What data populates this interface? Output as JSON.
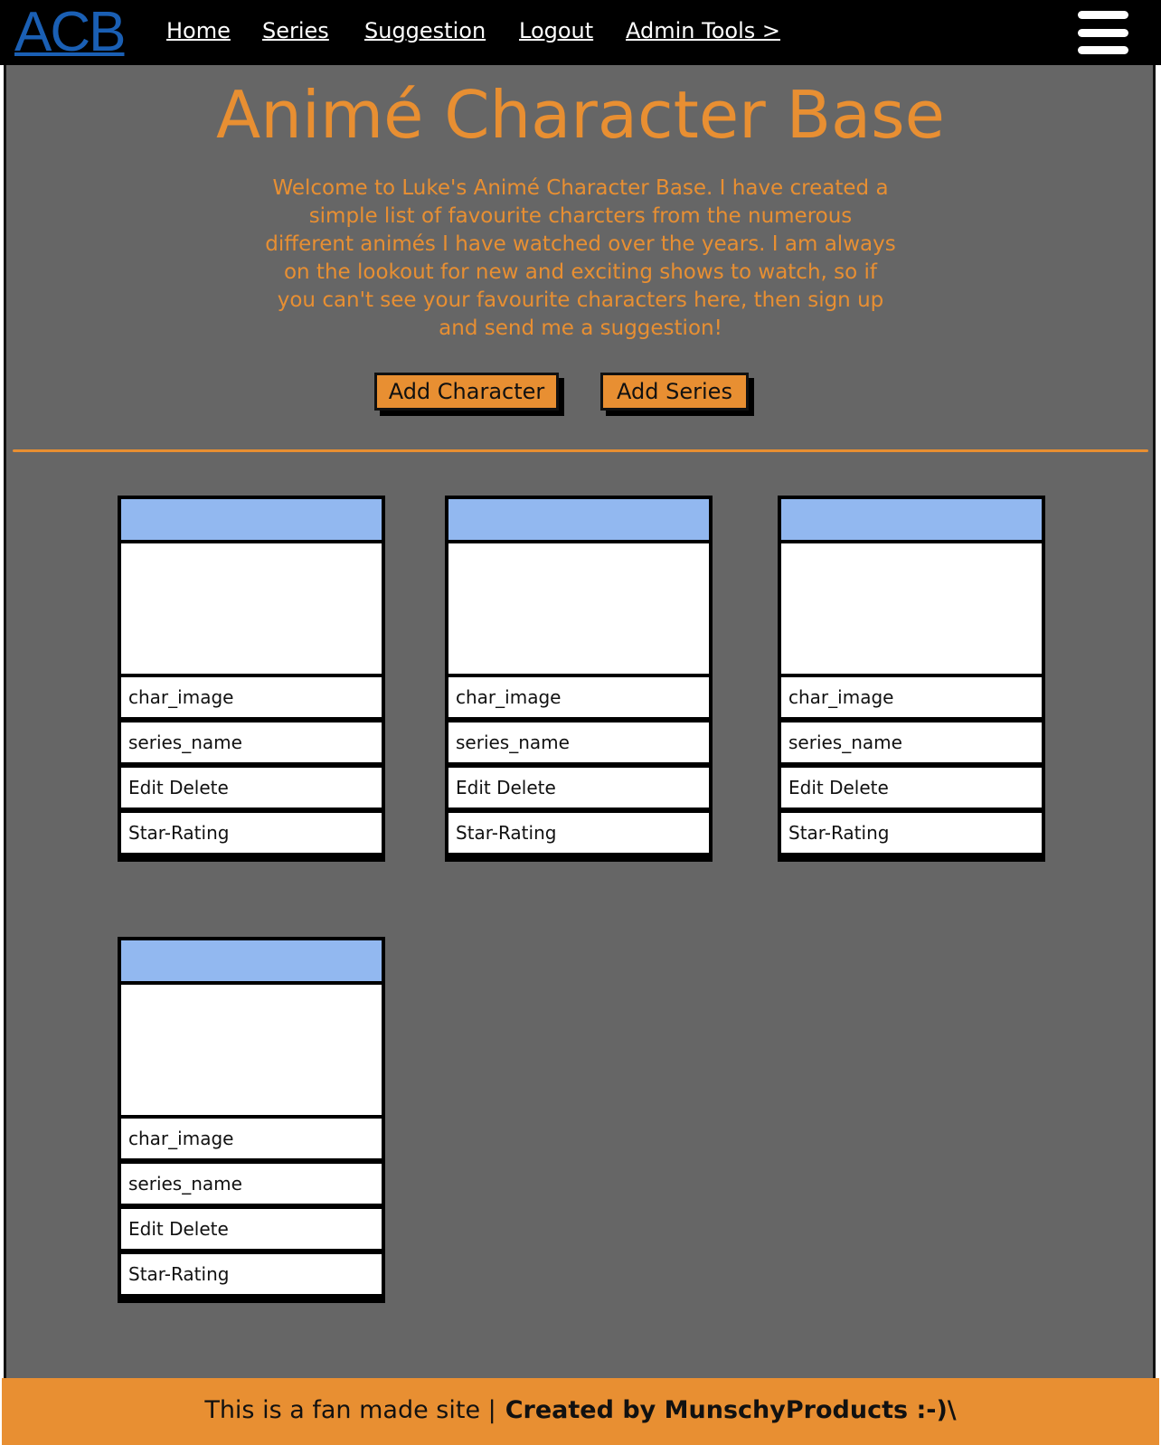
{
  "header": {
    "logo": "ACB",
    "nav": [
      {
        "label": "Home"
      },
      {
        "label": "Series"
      },
      {
        "label": "Suggestion"
      },
      {
        "label": "Logout"
      },
      {
        "label": "Admin Tools >"
      }
    ],
    "menu_icon": "hamburger-menu-icon"
  },
  "main": {
    "title": "Animé Character Base",
    "intro": "Welcome to Luke's Animé Character Base. I have created a simple list of favourite charcters from the numerous different animés I have watched over the years. I am always on the lookout for new and exciting shows to watch, so if you can't see your favourite characters here, then sign up and send me a suggestion!",
    "buttons": {
      "add_character": "Add Character",
      "add_series": "Add Series"
    },
    "cards": [
      {
        "image": "char_image",
        "series": "series_name",
        "actions": "Edit Delete",
        "rating": "Star-Rating"
      },
      {
        "image": "char_image",
        "series": "series_name",
        "actions": "Edit Delete",
        "rating": "Star-Rating"
      },
      {
        "image": "char_image",
        "series": "series_name",
        "actions": "Edit Delete",
        "rating": "Star-Rating"
      },
      {
        "image": "char_image",
        "series": "series_name",
        "actions": "Edit Delete",
        "rating": "Star-Rating"
      }
    ]
  },
  "footer": {
    "note": "This is a fan made site |",
    "credit": "Created by MunschyProducts :-)\\"
  },
  "colors": {
    "accent": "#e88f32",
    "background": "#666666",
    "nav_bg": "#000000",
    "logo": "#1a5fb4",
    "card_header": "#92b8f0"
  }
}
